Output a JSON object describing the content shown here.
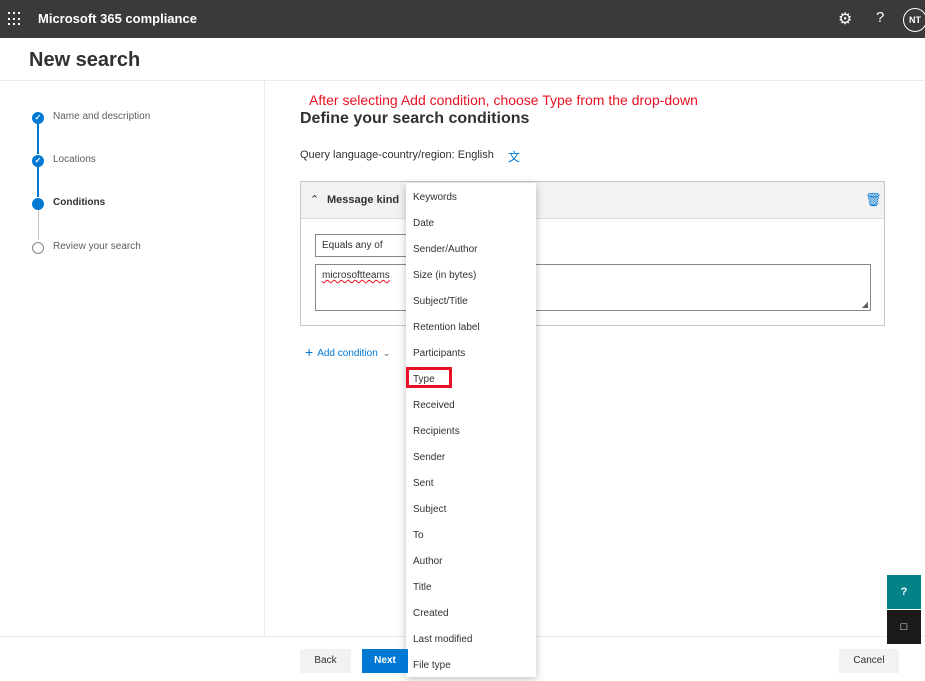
{
  "header": {
    "app_title": "Microsoft 365 compliance",
    "user_initials": "NT",
    "icons": [
      "waffle-icon",
      "gear-icon",
      "help-icon"
    ]
  },
  "page": {
    "title": "New search"
  },
  "steps": [
    {
      "label": "Name and description",
      "state": "done"
    },
    {
      "label": "Locations",
      "state": "done"
    },
    {
      "label": "Conditions",
      "state": "current"
    },
    {
      "label": "Review your search",
      "state": "pending"
    }
  ],
  "main": {
    "annotation": "After selecting Add condition, choose Type from the drop-down",
    "section_title": "Define your search conditions",
    "query_language": "Query language-country/region: English"
  },
  "condition_card": {
    "title": "Message kind",
    "operator": "Equals any of",
    "value": "microsoftteams"
  },
  "add_condition": {
    "label": "Add condition"
  },
  "dropdown": {
    "items": [
      "Keywords",
      "Date",
      "Sender/Author",
      "Size (in bytes)",
      "Subject/Title",
      "Retention label",
      "Participants",
      "Type",
      "Received",
      "Recipients",
      "Sender",
      "Sent",
      "Subject",
      "To",
      "Author",
      "Title",
      "Created",
      "Last modified",
      "File type"
    ],
    "highlighted": "Type"
  },
  "footer": {
    "back": "Back",
    "next": "Next",
    "cancel": "Cancel"
  },
  "colors": {
    "accent": "#0078d4",
    "annotation": "#e81123",
    "topbar": "#3b3a39"
  }
}
